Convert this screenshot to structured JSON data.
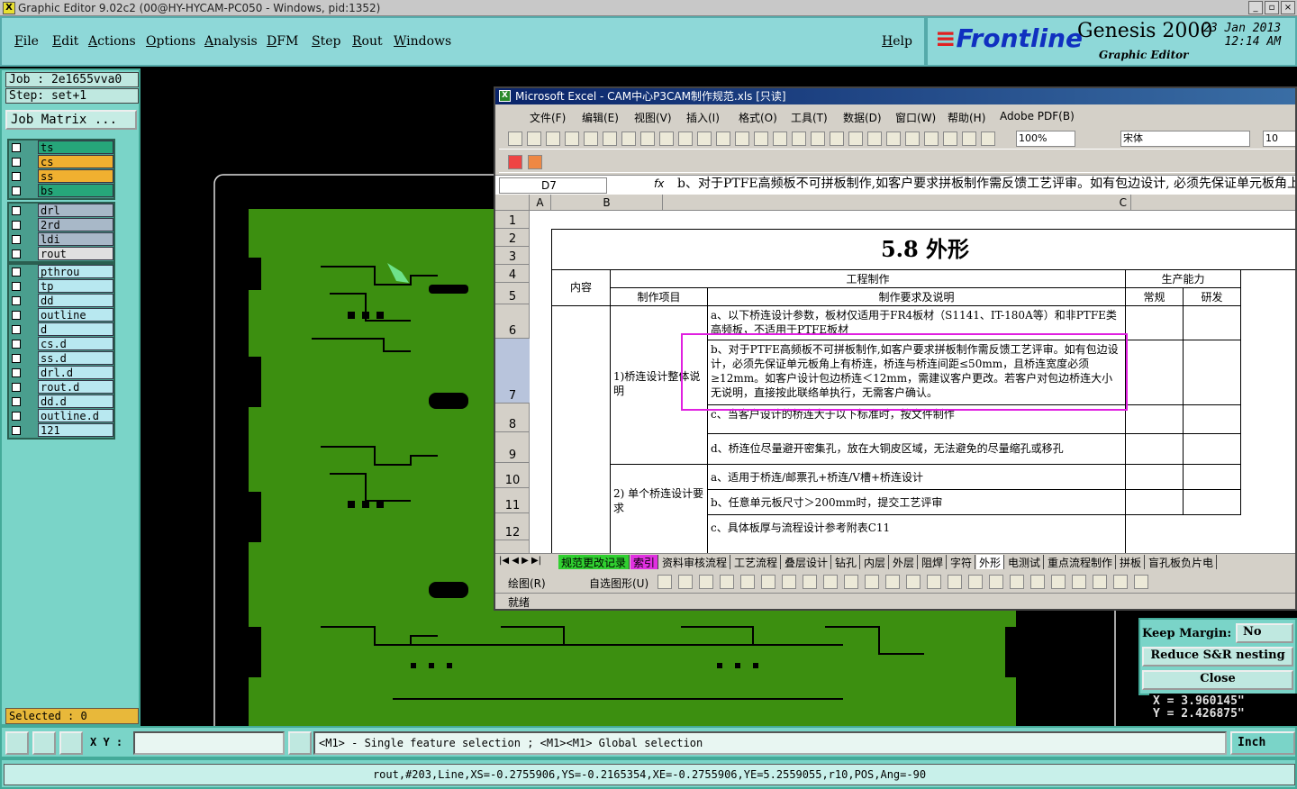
{
  "titlebar": {
    "title": "Graphic Editor 9.02c2 (00@HY-HYCAM-PC050 - Windows, pid:1352)"
  },
  "menu": [
    "File",
    "Edit",
    "Actions",
    "Options",
    "Analysis",
    "DFM",
    "Step",
    "Rout",
    "Windows"
  ],
  "help": "Help",
  "brand": {
    "logo": "Frontline",
    "product": "Genesis 2000",
    "subtitle": "Graphic Editor",
    "date": "23 Jan 2013",
    "time": "12:14 AM"
  },
  "job": {
    "job": "Job : 2e1655vva0",
    "step": "Step: set+1",
    "matrix": "Job Matrix ..."
  },
  "layers_group1": [
    {
      "name": "ts",
      "color": "#26a67a"
    },
    {
      "name": "cs",
      "color": "#f0b030"
    },
    {
      "name": "ss",
      "color": "#f0b030"
    },
    {
      "name": "bs",
      "color": "#26a67a"
    }
  ],
  "layers_group2": [
    {
      "name": "drl",
      "color": "#a8b8c8"
    },
    {
      "name": "2rd",
      "color": "#a8b8c8"
    },
    {
      "name": "ldi",
      "color": "#a8b8c8"
    },
    {
      "name": "rout",
      "color": "#e0e0e0"
    }
  ],
  "layers_group3": [
    {
      "name": "pthrou",
      "color": "#b8e8f0"
    },
    {
      "name": "tp",
      "color": "#b8e8f0"
    },
    {
      "name": "dd",
      "color": "#b8e8f0"
    },
    {
      "name": "outline",
      "color": "#b8e8f0"
    },
    {
      "name": "d",
      "color": "#b8e8f0"
    },
    {
      "name": "cs.d",
      "color": "#b8e8f0"
    },
    {
      "name": "ss.d",
      "color": "#b8e8f0"
    },
    {
      "name": "drl.d",
      "color": "#b8e8f0"
    },
    {
      "name": "rout.d",
      "color": "#b8e8f0"
    },
    {
      "name": "dd.d",
      "color": "#b8e8f0"
    },
    {
      "name": "outline.d",
      "color": "#b8e8f0"
    },
    {
      "name": "121",
      "color": "#b8e8f0"
    }
  ],
  "selected": "Selected : 0",
  "right": {
    "keep_margin_label": "Keep Margin:",
    "keep_margin_value": "No",
    "reduce": "Reduce S&R nesting",
    "close": "Close",
    "x": "X = 3.960145\"",
    "y": "Y = 2.426875\""
  },
  "bottom": {
    "xy_label": "X Y :",
    "message": "<M1> - Single feature selection ; <M1><M1> Global selection",
    "units": "Inch"
  },
  "status": "rout,#203,Line,XS=-0.2755906,YS=-0.2165354,XE=-0.2755906,YE=5.2559055,r10,POS,Ang=-90",
  "excel": {
    "title": "Microsoft Excel - CAM中心P3CAM制作规范.xls [只读]",
    "menu": [
      "文件(F)",
      "编辑(E)",
      "视图(V)",
      "插入(I)",
      "格式(O)",
      "工具(T)",
      "数据(D)",
      "窗口(W)",
      "帮助(H)",
      "Adobe PDF(B)"
    ],
    "zoom": "100%",
    "font": "宋体",
    "font_size": "10",
    "namebox": "D7",
    "formula": "b、对于PTFE高频板不可拼板制作,如客户要求拼板制作需反馈工艺评审。如有包边设计, 必须先保证单元板角上有桥连, 桥连与桥连间距≤50mm, 且桥连宽度必须≥12mm。如客户设计包边桥连＜12mm, 需建议客户更改。若客户对包边桥连大小无说明, 直接按此联络单执行, 无需客户确认。",
    "columns": [
      "A",
      "B",
      "C"
    ],
    "rows": [
      "1",
      "2",
      "3",
      "4",
      "5",
      "6",
      "7",
      "8",
      "9",
      "10",
      "11",
      "12"
    ],
    "sheet_title": "5.8 外形",
    "hdr_content": "内容",
    "hdr_engineering": "工程制作",
    "hdr_capability": "生产能力",
    "hdr_item": "制作项目",
    "hdr_requirement": "制作要求及说明",
    "hdr_regular": "常规",
    "hdr_rd": "研发",
    "item1": "1)桥连设计整体说明",
    "item2": "2) 单个桥连设计要求",
    "r6": "a、以下桥连设计参数，板材仅适用于FR4板材（S1141、IT-180A等）和非PTFE类高频板，不适用于PTFE板材",
    "r7": "b、对于PTFE高频板不可拼板制作,如客户要求拼板制作需反馈工艺评审。如有包边设计，必须先保证单元板角上有桥连，桥连与桥连间距≤50mm，且桥连宽度必须≥12mm。如客户设计包边桥连＜12mm，需建议客户更改。若客户对包边桥连大小无说明，直接按此联络单执行，无需客户确认。",
    "r8": "c、当客户设计的桥连大于以下标准时，按文件制作",
    "r9": "d、桥连位尽量避开密集孔，放在大铜皮区域，无法避免的尽量缩孔或移孔",
    "r10": "a、适用于桥连/邮票孔+桥连/V槽+桥连设计",
    "r11": "b、任意单元板尺寸＞200mm时，提交工艺评审",
    "r12": "c、具体板厚与流程设计参考附表C11",
    "tabs": [
      "规范更改记录",
      "索引",
      "资料审核流程",
      "工艺流程",
      "叠层设计",
      "钻孔",
      "内层",
      "外层",
      "阻焊",
      "字符",
      "外形",
      "电测试",
      "重点流程制作",
      "拼板",
      "盲孔板负片电"
    ],
    "draw_label": "绘图(R)",
    "autoshape_label": "自选图形(U)",
    "status": "就绪"
  }
}
